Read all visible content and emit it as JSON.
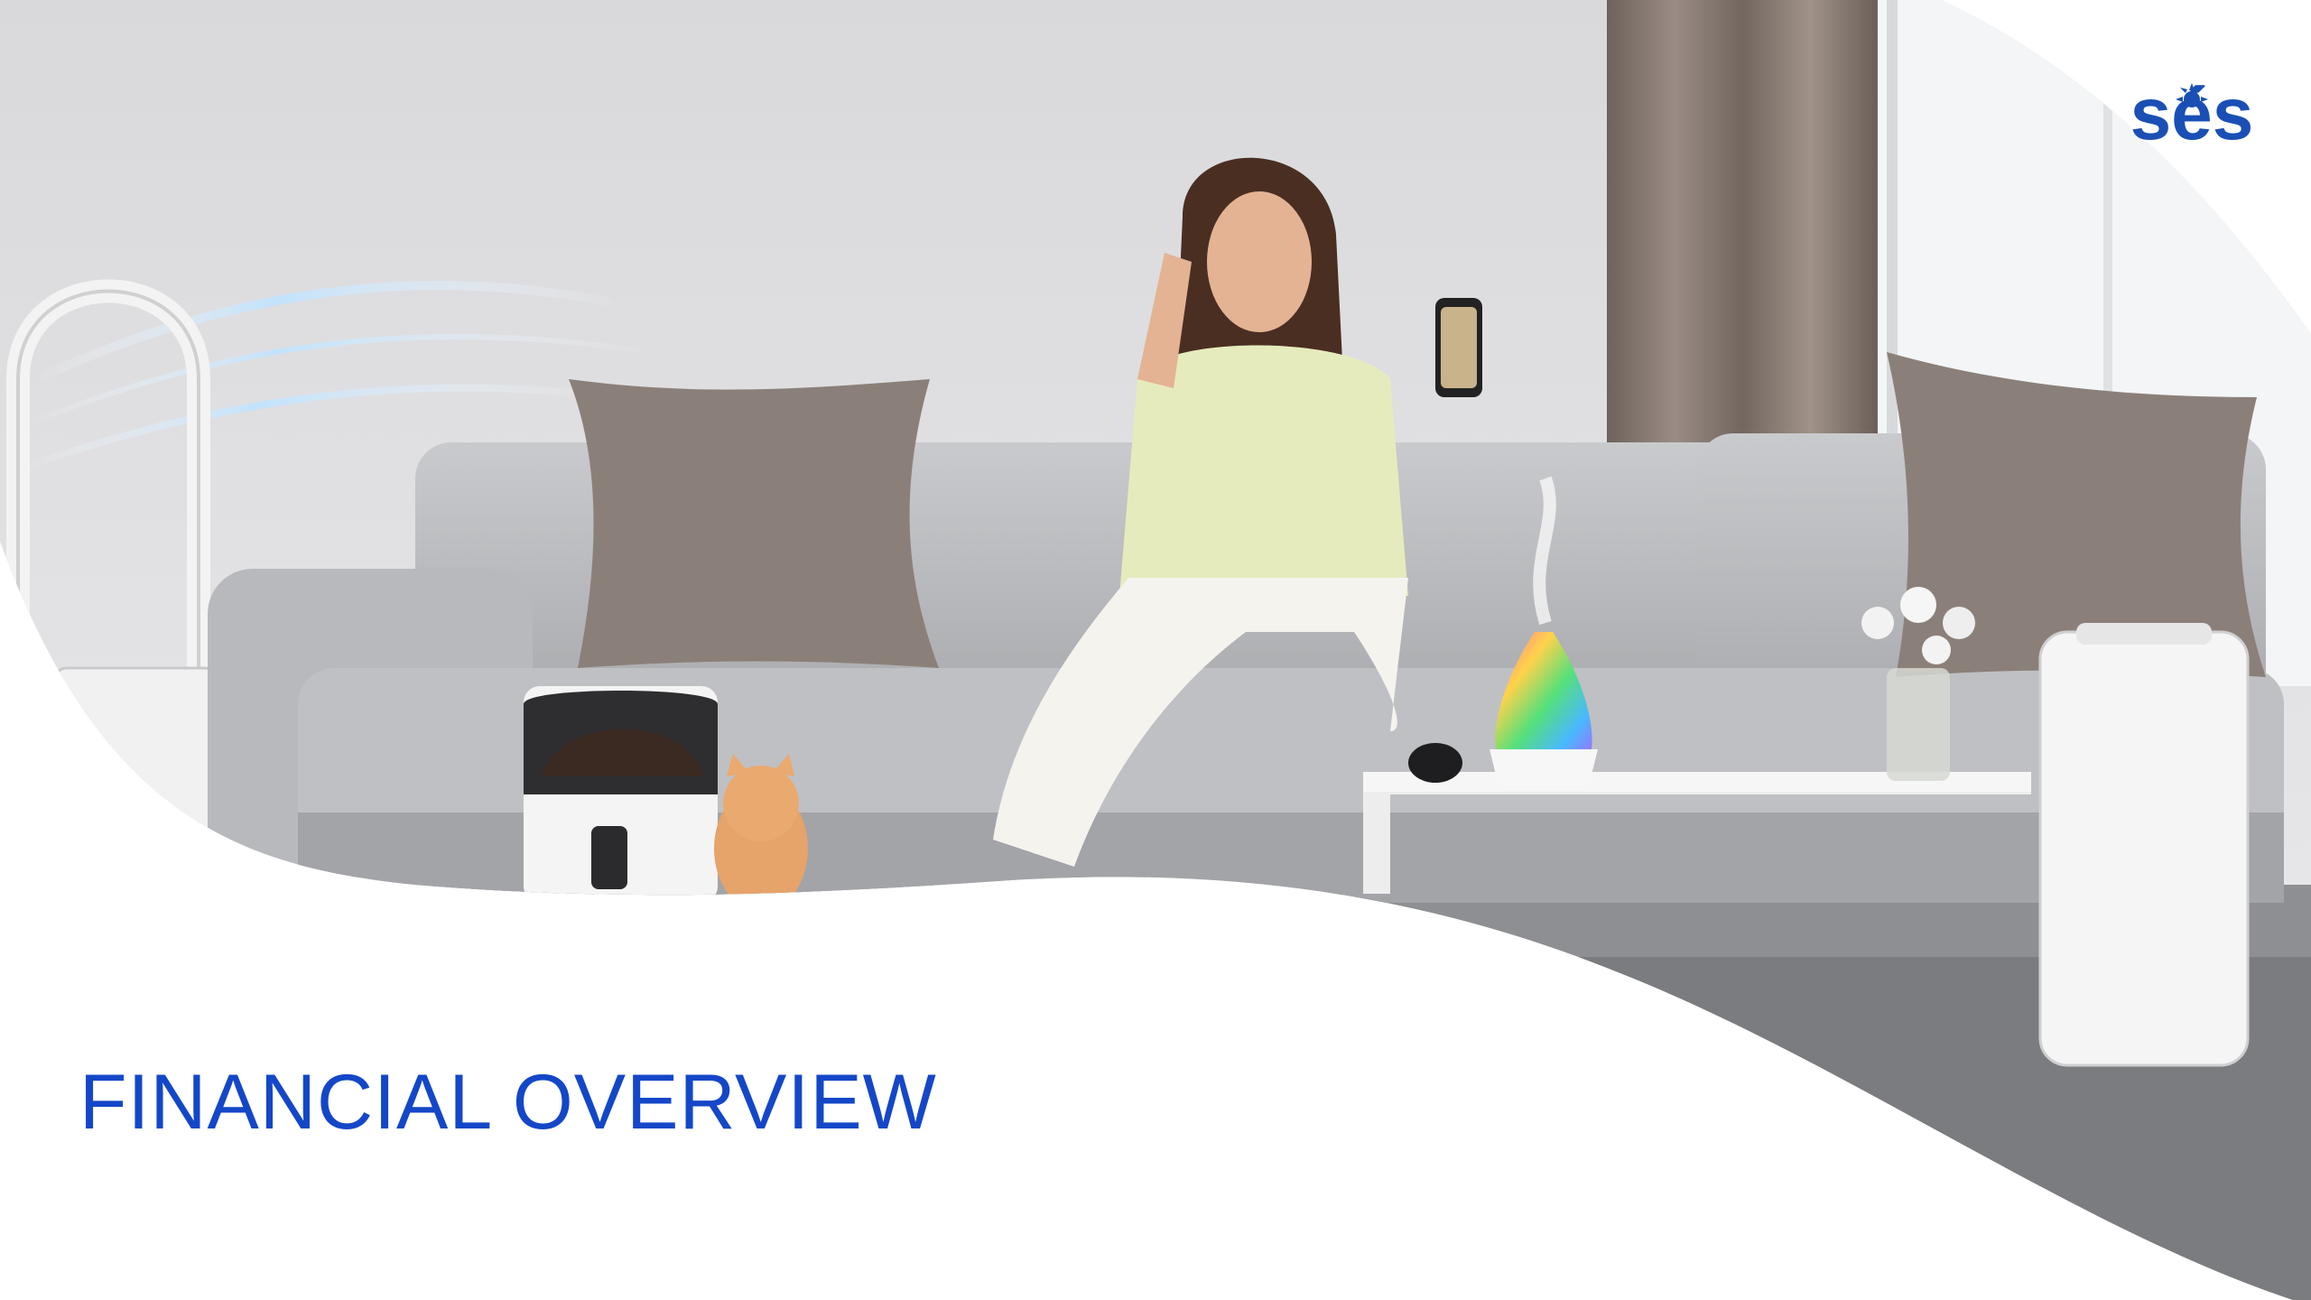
{
  "slide": {
    "title": "FINANCIAL OVERVIEW",
    "logo_text": "sés",
    "photo_description_icon": "living-room-photo",
    "colors": {
      "title": "#1447c8",
      "logo": "#1a4fb5",
      "background": "#ffffff"
    }
  }
}
